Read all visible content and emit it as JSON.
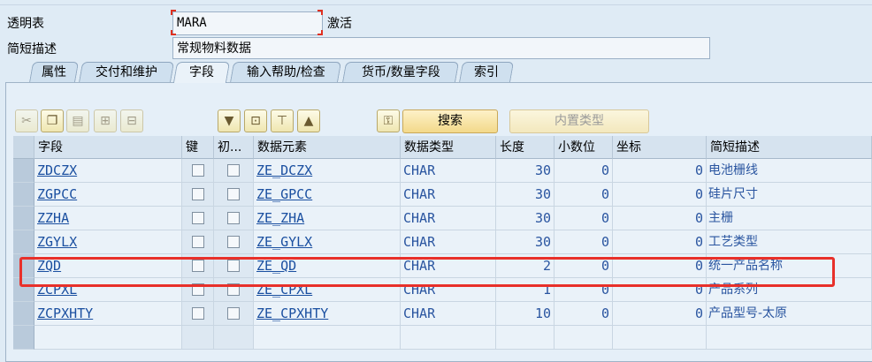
{
  "header": {
    "table_label": "透明表",
    "table_value": "MARA",
    "status": "激活",
    "desc_label": "简短描述",
    "desc_value": "常规物料数据"
  },
  "tabs": [
    {
      "label": "属性"
    },
    {
      "label": "交付和维护"
    },
    {
      "label": "字段",
      "active": true
    },
    {
      "label": "输入帮助/检查"
    },
    {
      "label": "货币/数量字段"
    },
    {
      "label": "索引"
    }
  ],
  "toolbar": {
    "icons": [
      "cut-icon",
      "copy-icon",
      "paste-icon",
      "insert-row-icon",
      "delete-row-icon",
      "collapse-icon",
      "expand-icon",
      "include-icon",
      "structure-icon",
      "key-icon"
    ],
    "search_label": "搜索",
    "builtin_type_label": "内置类型"
  },
  "table": {
    "columns": [
      "字段",
      "键",
      "初...",
      "数据元素",
      "数据类型",
      "长度",
      "小数位",
      "坐标",
      "简短描述"
    ],
    "rows": [
      {
        "field": "ZDCZX",
        "element": "ZE_DCZX",
        "type": "CHAR",
        "length": "30",
        "decimals": "0",
        "coord": "0",
        "desc": "电池栅线"
      },
      {
        "field": "ZGPCC",
        "element": "ZE_GPCC",
        "type": "CHAR",
        "length": "30",
        "decimals": "0",
        "coord": "0",
        "desc": "硅片尺寸"
      },
      {
        "field": "ZZHA",
        "element": "ZE_ZHA",
        "type": "CHAR",
        "length": "30",
        "decimals": "0",
        "coord": "0",
        "desc": "主栅"
      },
      {
        "field": "ZGYLX",
        "element": "ZE_GYLX",
        "type": "CHAR",
        "length": "30",
        "decimals": "0",
        "coord": "0",
        "desc": "工艺类型"
      },
      {
        "field": "ZQD",
        "element": "ZE_QD",
        "type": "CHAR",
        "length": "2",
        "decimals": "0",
        "coord": "0",
        "desc": "统一产品名称"
      },
      {
        "field": "ZCPXL",
        "element": "ZE_CPXL",
        "type": "CHAR",
        "length": "1",
        "decimals": "0",
        "coord": "0",
        "desc": "产品系列"
      },
      {
        "field": "ZCPXHTY",
        "element": "ZE_CPXHTY",
        "type": "CHAR",
        "length": "10",
        "decimals": "0",
        "coord": "0",
        "desc": "产品型号-太原"
      }
    ]
  },
  "colors": {
    "highlight": "#e8302a",
    "link": "#1a4fa0"
  }
}
